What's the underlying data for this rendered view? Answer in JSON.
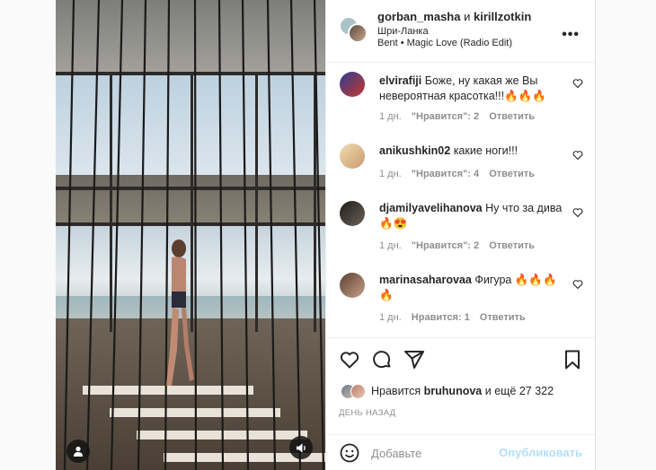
{
  "header": {
    "user1": "gorban_masha",
    "and": "и",
    "user2": "kirillzotkin",
    "location": "Шри-Ланка",
    "music_artist": "Bent",
    "music_separator": "•",
    "music_track": "Magic Love (Radio Edit)",
    "more": "•••"
  },
  "comments": [
    {
      "user": "elvirafiji",
      "text": "Боже, ну какая же Вы невероятная красотка!!!🔥🔥🔥",
      "time": "1 дн.",
      "likes": "\"Нравится\": 2",
      "reply": "Ответить",
      "avatar_color": "#c8372d"
    },
    {
      "user": "anikushkin02",
      "text": "какие ноги!!!",
      "time": "1 дн.",
      "likes": "\"Нравится\": 4",
      "reply": "Ответить",
      "avatar_color": "#e5c79a"
    },
    {
      "user": "djamilyavelihanova",
      "text": "Ну что за дива 🔥😍",
      "time": "1 дн.",
      "likes": "\"Нравится\": 2",
      "reply": "Ответить",
      "avatar_color": "#3a3634"
    },
    {
      "user": "marinasaharovaa",
      "text": "Фигура 🔥🔥🔥🔥",
      "time": "1 дн.",
      "likes": "Нравится: 1",
      "reply": "Ответить",
      "avatar_color": "#8a6a55"
    }
  ],
  "likes": {
    "prefix": "Нравится",
    "user": "bruhunova",
    "suffix": "и ещё 27 322"
  },
  "timeago": "ДЕНЬ НАЗАД",
  "compose": {
    "placeholder": "Добавьте",
    "publish": "Опубликовать"
  },
  "colors": {
    "accent_disabled": "#b2dffc",
    "muted": "#8e8e8e",
    "text": "#262626"
  }
}
